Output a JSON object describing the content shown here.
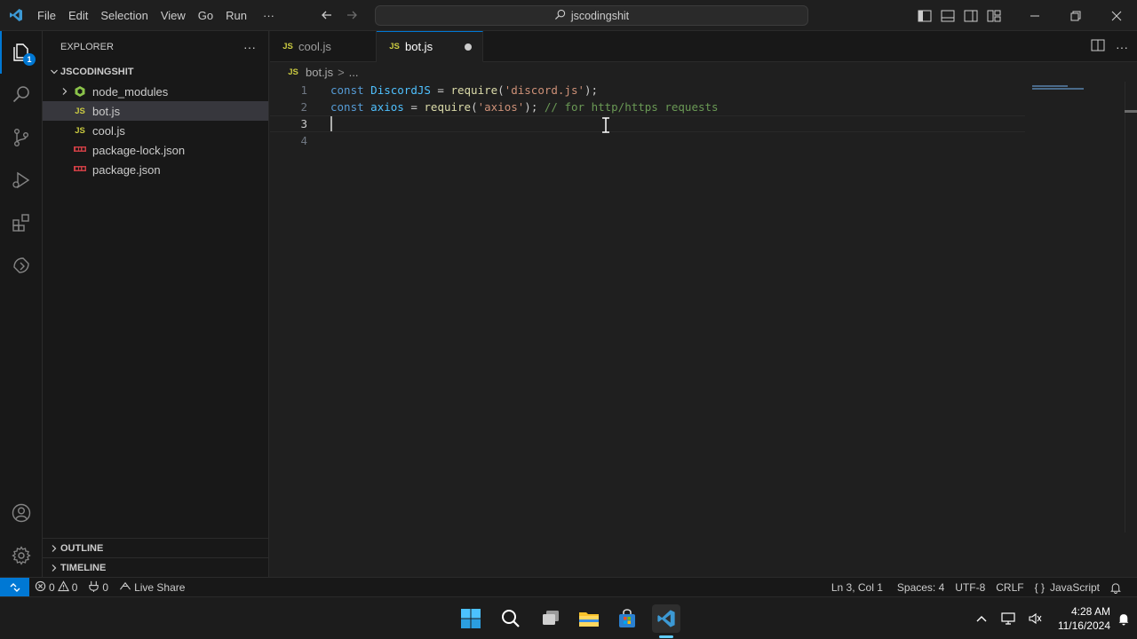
{
  "titlebar": {
    "menu": [
      "File",
      "Edit",
      "Selection",
      "View",
      "Go",
      "Run"
    ],
    "more_label": "···",
    "search_label": "jscodingshit"
  },
  "activitybar": {
    "explorer_badge": "1"
  },
  "sidebar": {
    "header": "EXPLORER",
    "more_label": "···",
    "folder_name": "JSCODINGSHIT",
    "items": [
      {
        "name": "node_modules",
        "type": "folder"
      },
      {
        "name": "bot.js",
        "type": "js",
        "icon_text": "JS"
      },
      {
        "name": "cool.js",
        "type": "js",
        "icon_text": "JS"
      },
      {
        "name": "package-lock.json",
        "type": "json"
      },
      {
        "name": "package.json",
        "type": "json"
      }
    ],
    "outline_label": "OUTLINE",
    "timeline_label": "TIMELINE"
  },
  "tabs": [
    {
      "label": "cool.js",
      "icon_text": "JS",
      "active": false
    },
    {
      "label": "bot.js",
      "icon_text": "JS",
      "active": true,
      "dirty": true
    }
  ],
  "breadcrumb": {
    "icon_text": "JS",
    "file": "bot.js",
    "separator": ">",
    "rest": "..."
  },
  "editor": {
    "line_numbers": [
      "1",
      "2",
      "3",
      "4"
    ],
    "current_line": 3,
    "line1": {
      "kw": "const",
      "var": "DiscordJS",
      "eq": " = ",
      "fn": "require",
      "open": "(",
      "str": "'discord.js'",
      "close": ");"
    },
    "line2": {
      "kw": "const",
      "var": "axios",
      "eq": " = ",
      "fn": "require",
      "open": "(",
      "str": "'axios'",
      "close": ");",
      "comment": "// for http/https requests"
    }
  },
  "statusbar": {
    "errors": "0",
    "warnings": "0",
    "ports": "0",
    "live_share": "Live Share",
    "position": "Ln 3, Col 1",
    "spaces": "Spaces: 4",
    "encoding": "UTF-8",
    "eol": "CRLF",
    "language": "JavaScript",
    "language_icon": "{ }"
  },
  "taskbar": {
    "time": "4:28 AM",
    "date": "11/16/2024"
  },
  "colors": {
    "accent": "#0078d4",
    "js_icon": "#cbcb41",
    "json_icon": "#cc3e44",
    "keyword": "#569cd6",
    "variable": "#4fc1ff",
    "function": "#dcdcaa",
    "string": "#ce9178",
    "comment": "#6a9955"
  },
  "icons": {
    "activity": [
      "explorer-icon",
      "search-icon",
      "source-control-icon",
      "run-debug-icon",
      "extensions-icon",
      "remote-explorer-icon",
      "accounts-icon",
      "manage-gear-icon"
    ]
  }
}
